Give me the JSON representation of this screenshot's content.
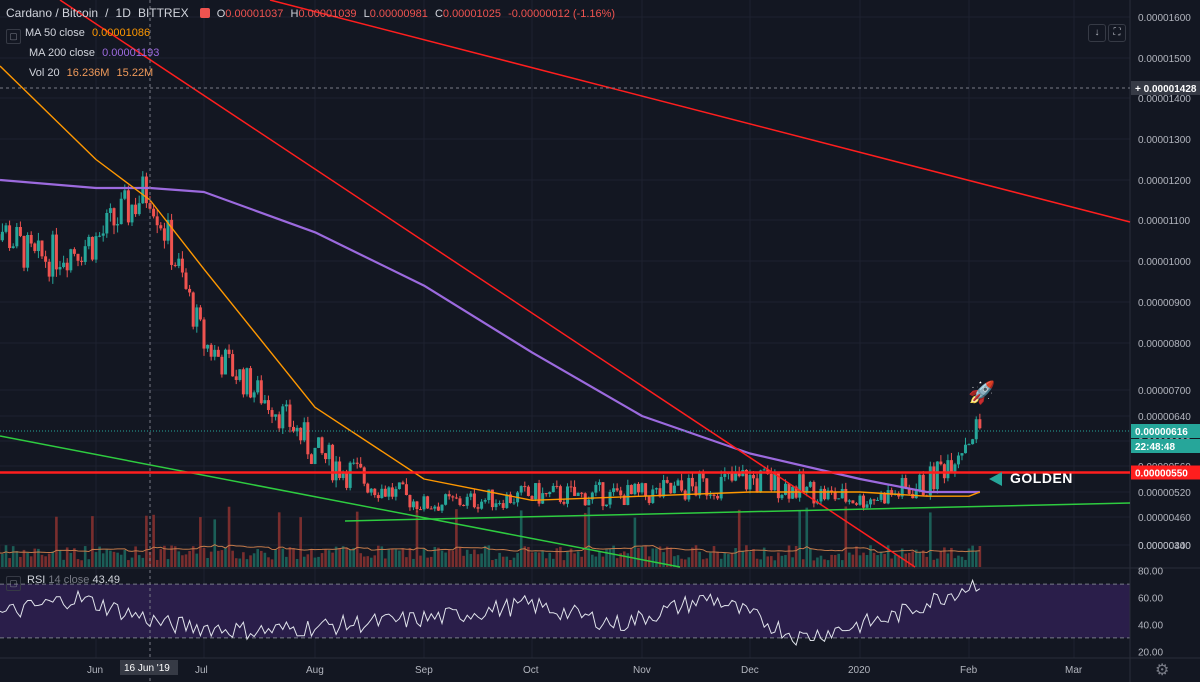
{
  "header": {
    "symbol": "Cardano / Bitcoin",
    "interval": "1D",
    "exchange": "BITTREX",
    "ohlc": {
      "o_label": "O",
      "o": "0.00001037",
      "h_label": "H",
      "h": "0.00001039",
      "l_label": "L",
      "l": "0.00000981",
      "c_label": "C",
      "c": "0.00001025",
      "change": "-0.00000012 (-1.16%)"
    }
  },
  "indicators": [
    {
      "label": "MA 50 close",
      "value": "0.00001086",
      "color": "#ff9800"
    },
    {
      "label": "MA 200 close",
      "value": "0.00001193",
      "color": "#9c6ade"
    },
    {
      "label": "Vol 20",
      "value": "16.236M",
      "value2": "15.22M",
      "color": "#ef9a5a"
    }
  ],
  "rsi": {
    "label": "RSI",
    "params": "14 close",
    "value": "43.49"
  },
  "annotation": {
    "text": "GOLDEN"
  },
  "price_axis": {
    "ticks": [
      "0.00001600",
      "0.00001500",
      "0.00001400",
      "0.00001300",
      "0.00001200",
      "0.00001100",
      "0.00001000",
      "0.00000900",
      "0.00000800",
      "0.00000700",
      "0.00000640",
      "0.00000600",
      "0.00000560",
      "0.00000520",
      "0.00000460",
      "0.00000400",
      "0.00000340"
    ],
    "crosshair_label": "0.00001428",
    "last_price_label": "0.00000616",
    "countdown_label": "22:48:48",
    "resistance_label": "0.00000550"
  },
  "rsi_axis": {
    "ticks": [
      "80.00",
      "60.00",
      "40.00",
      "20.00"
    ]
  },
  "time_axis": {
    "ticks": [
      "Jun",
      "Jul",
      "Aug",
      "Sep",
      "Oct",
      "Nov",
      "Dec",
      "2020",
      "Feb",
      "Mar"
    ],
    "crosshair_label": "16 Jun '19"
  },
  "colors": {
    "background": "#131722",
    "up": "#26a69a",
    "down": "#ef5350",
    "ma50": "#ff9800",
    "ma200": "#9c6ade",
    "trend_red": "#ff1e1e",
    "trend_green": "#2ecc40",
    "rsi_band": "#2a1e4a"
  },
  "chart_data": {
    "type": "line",
    "title": "Cardano / Bitcoin · 1D · BITTREX",
    "x": [
      "2019-06-01",
      "2019-06-16",
      "2019-07-01",
      "2019-08-01",
      "2019-09-01",
      "2019-10-01",
      "2019-11-01",
      "2019-12-01",
      "2020-01-01",
      "2020-01-20",
      "2020-02-01",
      "2020-02-04"
    ],
    "series": [
      {
        "name": "Cardano / Bitcoin",
        "values": [
          1.05e-05,
          1.18e-05,
          8e-06,
          5.8e-06,
          4.9e-06,
          5.1e-06,
          5.1e-06,
          5.4e-06,
          5e-06,
          5.3e-06,
          6.1e-06,
          6.2e-06
        ]
      },
      {
        "name": "MA 50 close",
        "values": [
          1.25e-05,
          1.15e-05,
          9.8e-06,
          6.6e-06,
          5.4e-06,
          5e-06,
          5.1e-06,
          5.2e-06,
          5.2e-06,
          5.1e-06,
          5.1e-06,
          5.2e-06
        ]
      },
      {
        "name": "MA 200 close",
        "values": [
          1.18e-05,
          1.18e-05,
          1.17e-05,
          1.07e-05,
          9.4e-06,
          7.8e-06,
          6.4e-06,
          5.8e-06,
          5.4e-06,
          5.2e-06,
          5.2e-06,
          5.2e-06
        ]
      }
    ],
    "horizontal_levels": [
      5.5e-06
    ],
    "ylim": [
      2.9e-06,
      1.65e-05
    ],
    "rsi_values": [
      45,
      60,
      40,
      35,
      40,
      45,
      55,
      40,
      60,
      30,
      45,
      72
    ],
    "rsi_ylim": [
      15,
      82
    ]
  }
}
